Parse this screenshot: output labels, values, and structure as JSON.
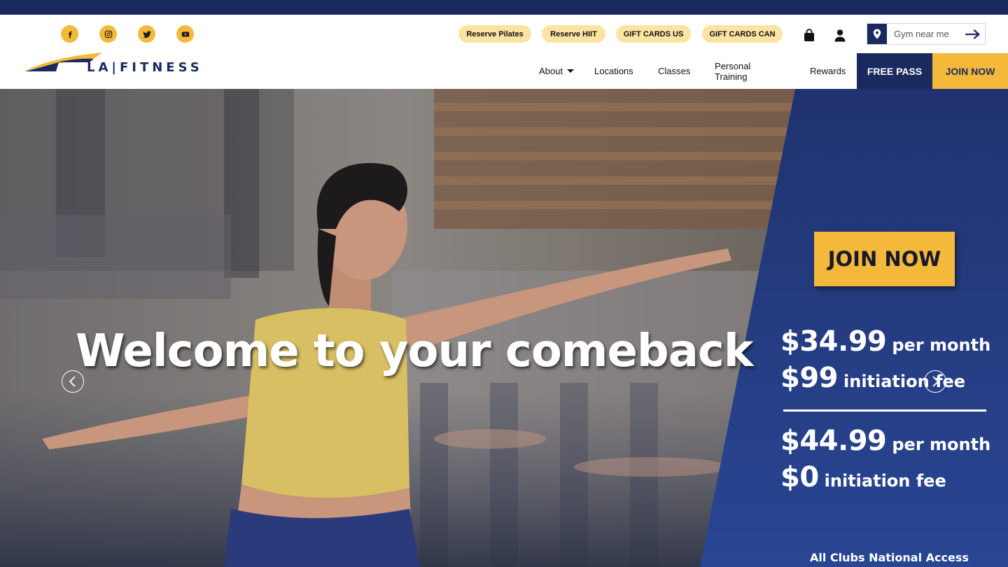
{
  "social": [
    {
      "name": "facebook-icon"
    },
    {
      "name": "instagram-icon"
    },
    {
      "name": "twitter-icon"
    },
    {
      "name": "youtube-icon"
    }
  ],
  "quick_links": [
    "Reserve Pilates",
    "Reserve HIIT",
    "GIFT CARDS US",
    "GIFT CARDS CAN"
  ],
  "header_icons": [
    "shopping-bag-icon",
    "user-icon"
  ],
  "gym_search": {
    "placeholder": "Gym near me"
  },
  "logo": {
    "text": "LA|FITNESS"
  },
  "nav": {
    "about": "About",
    "locations": "Locations",
    "classes": "Classes",
    "personal_training": "Personal Training",
    "rewards": "Rewards",
    "free_pass": "FREE PASS",
    "join_now": "JOIN NOW"
  },
  "hero": {
    "title": "Welcome to your comeback",
    "cta": "JOIN NOW",
    "offer1": {
      "price": "$34.99",
      "period": "per month",
      "fee": "$99",
      "fee_label": "initiation fee"
    },
    "offer2": {
      "price": "$44.99",
      "period": "per month",
      "fee": "$0",
      "fee_label": "initiation fee"
    },
    "access": "All Clubs National Access"
  },
  "colors": {
    "navy": "#1b2a5e",
    "gold": "#f4b93b",
    "pill": "#fbe3a2",
    "promo_blue": "#22397d"
  }
}
